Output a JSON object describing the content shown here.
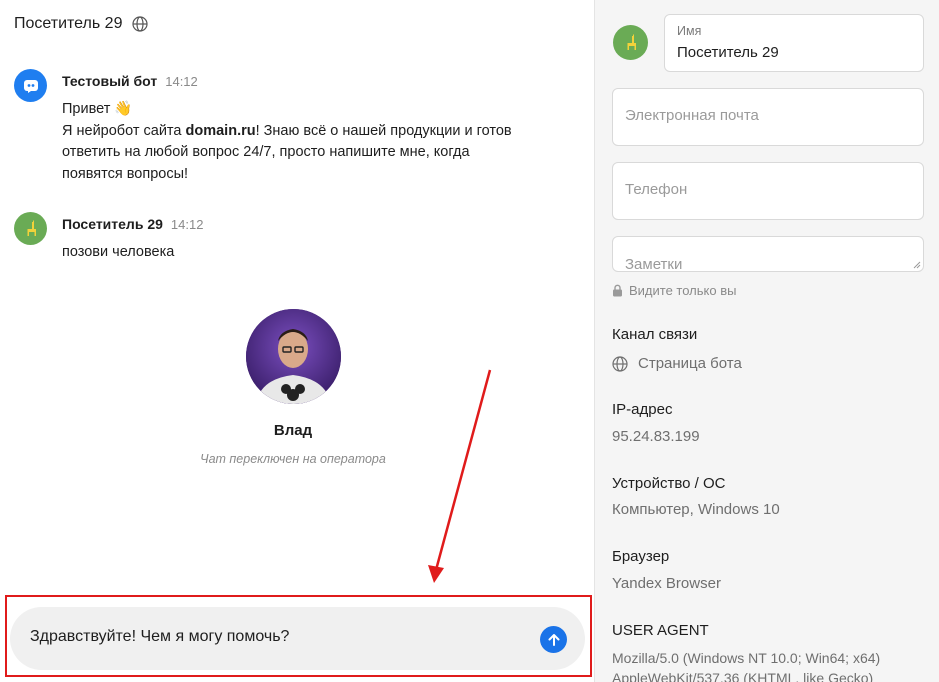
{
  "chat": {
    "title": "Посетитель 29",
    "messages": [
      {
        "name": "Тестовый бот",
        "time": "14:12",
        "line1": "Привет 👋",
        "line2_before": "Я нейробот сайта ",
        "line2_bold": "domain.ru",
        "line2_after": "! Знаю всё о нашей продукции и готов",
        "line3": "ответить на любой вопрос 24/7, просто напишите мне, когда",
        "line4": "появятся вопросы!"
      },
      {
        "name": "Посетитель 29",
        "time": "14:12",
        "text": "позови человека"
      }
    ],
    "operator": {
      "name": "Влад",
      "note": "Чат переключен на оператора"
    },
    "input": {
      "value": "Здравствуйте! Чем я могу помочь?"
    }
  },
  "sidebar": {
    "name_label": "Имя",
    "name_value": "Посетитель 29",
    "email_placeholder": "Электронная почта",
    "phone_placeholder": "Телефон",
    "notes_placeholder": "Заметки",
    "private_note": "Видите только вы",
    "channel_label": "Канал связи",
    "channel_value": "Страница бота",
    "ip_label": "IP-адрес",
    "ip_value": "95.24.83.199",
    "device_label": "Устройство / ОС",
    "device_value": "Компьютер, Windows 10",
    "browser_label": "Браузер",
    "browser_value": "Yandex Browser",
    "ua_label": "USER AGENT",
    "ua_value": "Mozilla/5.0 (Windows NT 10.0; Win64; x64) AppleWebKit/537.36 (KHTML, like Gecko)"
  },
  "colors": {
    "accent_blue": "#1a73e8",
    "bot_avatar": "#1f7ef0",
    "visitor_avatar": "#6aab55",
    "highlight_red": "#e01b1b"
  },
  "icons": [
    "globe-icon",
    "bot-icon",
    "llama-icon",
    "send-arrow-icon",
    "lock-icon"
  ]
}
